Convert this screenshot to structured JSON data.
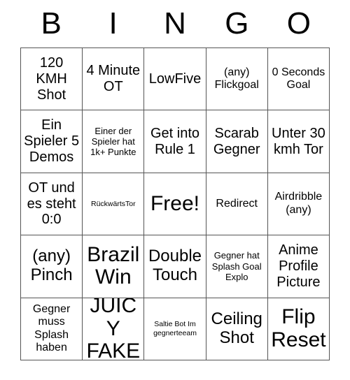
{
  "card": {
    "title": "BINGO",
    "header_letters": [
      "B",
      "I",
      "N",
      "G",
      "O"
    ],
    "free_space": {
      "row": 2,
      "col": 2,
      "label": "Free!"
    },
    "colors": {
      "background": "#ffffff",
      "text": "#000000",
      "grid_line": "#555555"
    },
    "rows": [
      [
        {
          "text": "120 KMH Shot",
          "size": "l"
        },
        {
          "text": "4 Minute OT",
          "size": "l"
        },
        {
          "text": "LowFive",
          "size": "l"
        },
        {
          "text": "(any) Flickgoal",
          "size": "m"
        },
        {
          "text": "0 Seconds Goal",
          "size": "m"
        }
      ],
      [
        {
          "text": "Ein Spieler 5 Demos",
          "size": "l"
        },
        {
          "text": "Einer der Spieler hat 1k+ Punkte",
          "size": "s"
        },
        {
          "text": "Get into Rule 1",
          "size": "l"
        },
        {
          "text": "Scarab Gegner",
          "size": "l"
        },
        {
          "text": "Unter 30 kmh Tor",
          "size": "l"
        }
      ],
      [
        {
          "text": "OT und es steht 0:0",
          "size": "l"
        },
        {
          "text": "RückwärtsTor",
          "size": "xs"
        },
        {
          "text": "Free!",
          "size": "xxl"
        },
        {
          "text": "Redirect",
          "size": "m"
        },
        {
          "text": "Airdribble (any)",
          "size": "m"
        }
      ],
      [
        {
          "text": "(any) Pinch",
          "size": "xl"
        },
        {
          "text": "Brazil Win",
          "size": "xxl"
        },
        {
          "text": "Double Touch",
          "size": "xl"
        },
        {
          "text": "Gegner hat Splash Goal Explo",
          "size": "s"
        },
        {
          "text": "Anime Profile Picture",
          "size": "l"
        }
      ],
      [
        {
          "text": "Gegner muss Splash haben",
          "size": "m"
        },
        {
          "text": "JUICY FAKE",
          "size": "xxl"
        },
        {
          "text": "Saltie Bot Im gegnerteeam",
          "size": "xs"
        },
        {
          "text": "Ceiling Shot",
          "size": "xl"
        },
        {
          "text": "Flip Reset",
          "size": "xxl"
        }
      ]
    ]
  }
}
